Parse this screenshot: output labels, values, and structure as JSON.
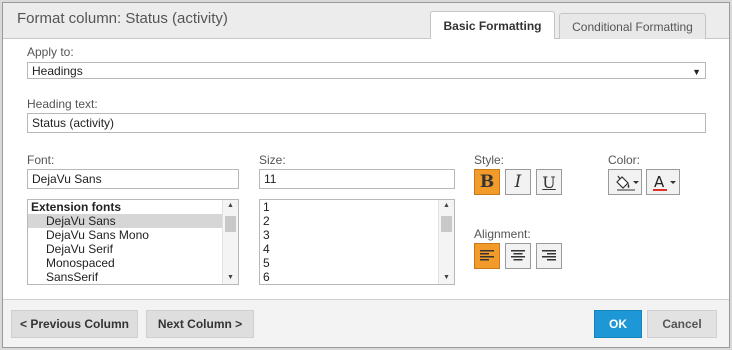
{
  "dialog": {
    "title": "Format column: Status (activity)"
  },
  "tabs": [
    {
      "label": "Basic Formatting",
      "active": true
    },
    {
      "label": "Conditional Formatting",
      "active": false
    }
  ],
  "apply_to": {
    "label": "Apply to:",
    "value": "Headings"
  },
  "heading_text": {
    "label": "Heading text:",
    "value": "Status (activity)"
  },
  "font": {
    "label": "Font:",
    "value": "DejaVu Sans",
    "list": {
      "group": "Extension fonts",
      "items": [
        "DejaVu Sans",
        "DejaVu Sans Mono",
        "DejaVu Serif",
        "Monospaced",
        "SansSerif"
      ],
      "selected": "DejaVu Sans"
    }
  },
  "size": {
    "label": "Size:",
    "value": "11",
    "list": {
      "items": [
        "1",
        "2",
        "3",
        "4",
        "5",
        "6"
      ]
    }
  },
  "style": {
    "label": "Style:",
    "bold": {
      "glyph": "B",
      "active": true
    },
    "italic": {
      "glyph": "I",
      "active": false
    },
    "underline": {
      "glyph": "U",
      "active": false
    }
  },
  "color": {
    "label": "Color:",
    "fill_icon": "paint-bucket-icon",
    "text_icon": "text-color-icon",
    "text_glyph": "A"
  },
  "alignment": {
    "label": "Alignment:",
    "left_active": true,
    "icons": [
      "align-left-icon",
      "align-center-icon",
      "align-right-icon"
    ]
  },
  "footer": {
    "previous": "< Previous Column",
    "next": "Next Column >",
    "ok": "OK",
    "cancel": "Cancel"
  },
  "colors": {
    "accent_orange": "#f39b2a",
    "ok_blue": "#1e97d6",
    "text_underline_red": "#e0302a"
  }
}
